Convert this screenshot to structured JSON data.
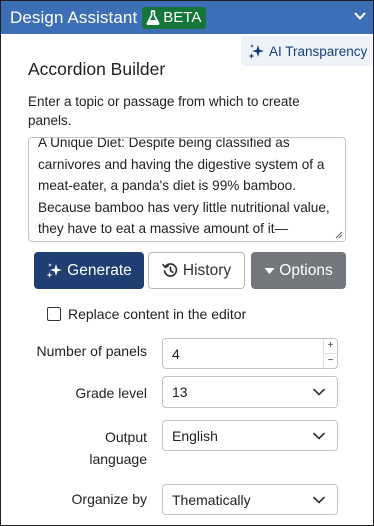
{
  "header": {
    "title": "Design Assistant",
    "badge": "BETA",
    "colors": {
      "bar": "#3d6fb6",
      "badge": "#16763a"
    }
  },
  "ai_transparency": {
    "label": "AI Transparency"
  },
  "main": {
    "title": "Accordion Builder",
    "instructions": "Enter a topic or passage from which to create panels.",
    "passage": "A Unique Diet: Despite being classified as carnivores and having the digestive system of a meat-eater, a panda's diet is 99% bamboo. Because bamboo has very little nutritional value, they have to eat a massive amount of it—"
  },
  "buttons": {
    "generate": "Generate",
    "history": "History",
    "options": "Options"
  },
  "replace_checkbox": {
    "label": "Replace content in the editor",
    "checked": false
  },
  "fields": {
    "panels": {
      "label": "Number of panels",
      "value": "4",
      "inc": "+",
      "dec": "−"
    },
    "grade": {
      "label": "Grade level",
      "value": "13"
    },
    "language": {
      "label_line1": "Output",
      "label_line2": "language",
      "value": "English"
    },
    "organize": {
      "label": "Organize by",
      "value": "Thematically"
    }
  }
}
